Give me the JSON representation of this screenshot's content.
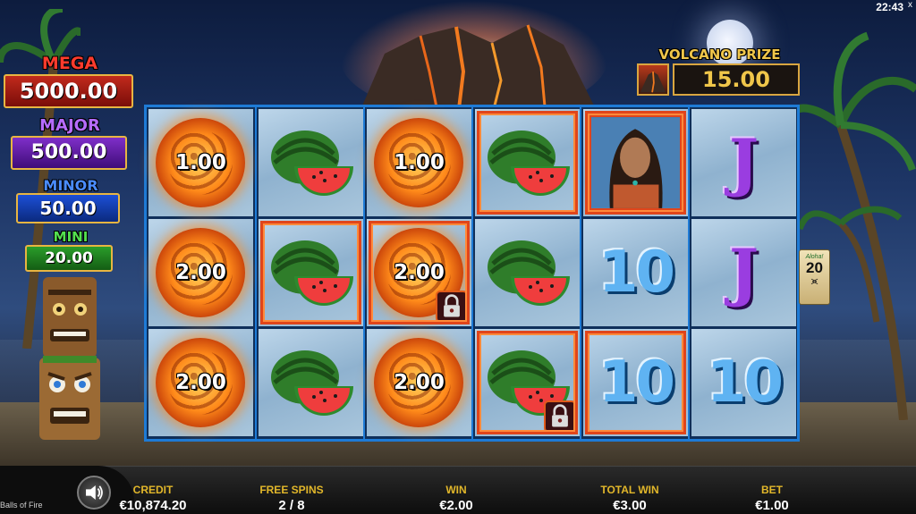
{
  "clock": {
    "time": "22:43",
    "close_symbol": "x"
  },
  "jackpots": {
    "mega": {
      "label": "MEGA",
      "value": "5000.00"
    },
    "major": {
      "label": "MAJOR",
      "value": "500.00"
    },
    "minor": {
      "label": "MINOR",
      "value": "50.00"
    },
    "mini": {
      "label": "MINI",
      "value": "20.00"
    }
  },
  "volcano_prize": {
    "label": "VOLCANO PRIZE",
    "value": "15.00"
  },
  "reels": [
    [
      {
        "type": "fireball",
        "value": "1.00",
        "held": false,
        "locked": false
      },
      {
        "type": "fireball",
        "value": "2.00",
        "held": false,
        "locked": false
      },
      {
        "type": "fireball",
        "value": "2.00",
        "held": false,
        "locked": false
      }
    ],
    [
      {
        "type": "watermelon",
        "held": false,
        "locked": false
      },
      {
        "type": "watermelon",
        "held": true,
        "locked": false
      },
      {
        "type": "watermelon",
        "held": false,
        "locked": false
      }
    ],
    [
      {
        "type": "fireball",
        "value": "1.00",
        "held": false,
        "locked": false
      },
      {
        "type": "fireball",
        "value": "2.00",
        "held": true,
        "locked": true
      },
      {
        "type": "fireball",
        "value": "2.00",
        "held": false,
        "locked": false
      }
    ],
    [
      {
        "type": "watermelon",
        "held": true,
        "locked": false
      },
      {
        "type": "watermelon",
        "held": false,
        "locked": false
      },
      {
        "type": "watermelon",
        "held": true,
        "locked": true
      }
    ],
    [
      {
        "type": "woman",
        "held": true,
        "locked": false
      },
      {
        "type": "ten",
        "label": "10",
        "held": false,
        "locked": false
      },
      {
        "type": "ten",
        "label": "10",
        "held": true,
        "locked": false
      }
    ],
    [
      {
        "type": "j",
        "label": "J",
        "held": false,
        "locked": false
      },
      {
        "type": "j",
        "label": "J",
        "held": false,
        "locked": false
      },
      {
        "type": "ten",
        "label": "10",
        "held": false,
        "locked": false
      }
    ]
  ],
  "side_card": {
    "script": "Aloha!",
    "number": "20",
    "mark": "⪤"
  },
  "bottom_bar": {
    "game_name": "Balls of Fire",
    "credit": {
      "label": "CREDIT",
      "value": "€10,874.20"
    },
    "free_spins": {
      "label": "FREE SPINS",
      "value": "2 / 8"
    },
    "win": {
      "label": "WIN",
      "value": "€2.00"
    },
    "total_win": {
      "label": "TOTAL WIN",
      "value": "€3.00"
    },
    "bet": {
      "label": "BET",
      "value": "€1.00"
    }
  },
  "icons": {
    "sound": "speaker-icon",
    "lock": "padlock-icon"
  }
}
